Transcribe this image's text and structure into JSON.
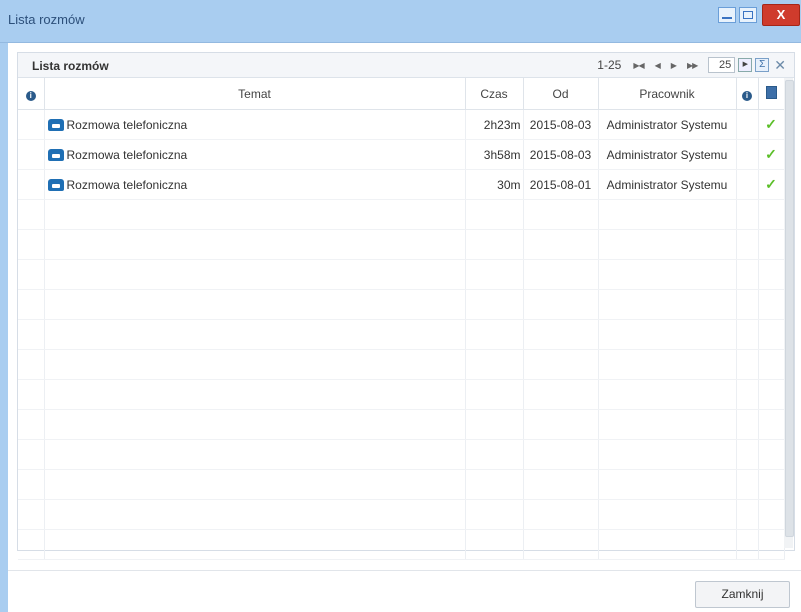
{
  "window": {
    "title": "Lista rozmów",
    "close_label": "X"
  },
  "panel": {
    "title": "Lista rozmów",
    "pager": {
      "range": "1-25",
      "page_size": "25"
    }
  },
  "table": {
    "columns": {
      "temat": "Temat",
      "czas": "Czas",
      "od": "Od",
      "pracownik": "Pracownik"
    },
    "rows": [
      {
        "temat": "Rozmowa telefoniczna",
        "czas": "2h23m",
        "od": "2015-08-03",
        "pracownik": "Administrator Systemu"
      },
      {
        "temat": "Rozmowa telefoniczna",
        "czas": "3h58m",
        "od": "2015-08-03",
        "pracownik": "Administrator Systemu"
      },
      {
        "temat": "Rozmowa telefoniczna",
        "czas": "30m",
        "od": "2015-08-01",
        "pracownik": "Administrator Systemu"
      }
    ]
  },
  "footer": {
    "close_button": "Zamknij"
  }
}
